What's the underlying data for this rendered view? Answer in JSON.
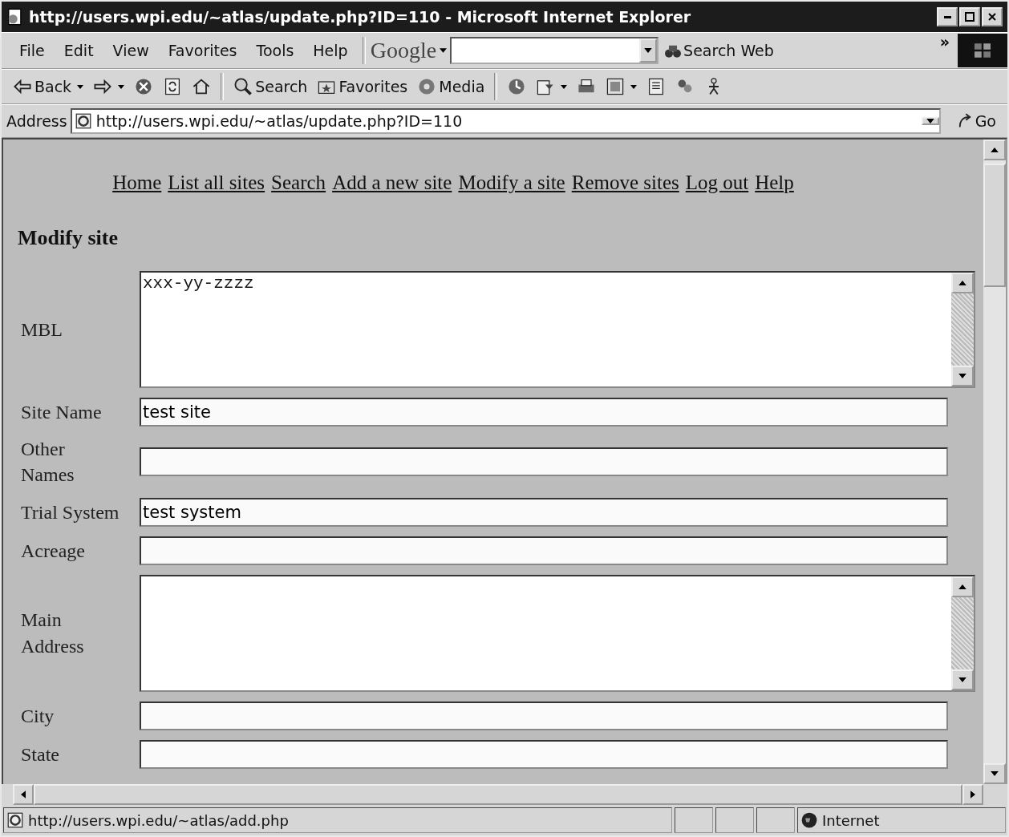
{
  "window": {
    "title": "http://users.wpi.edu/~atlas/update.php?ID=110 - Microsoft Internet Explorer"
  },
  "menu": [
    "File",
    "Edit",
    "View",
    "Favorites",
    "Tools",
    "Help"
  ],
  "google": {
    "logo": "Google",
    "button": "Search Web"
  },
  "chevron": "»",
  "toolbar": [
    {
      "kind": "back",
      "label": "Back"
    },
    {
      "kind": "forward"
    },
    {
      "kind": "stop"
    },
    {
      "kind": "refresh"
    },
    {
      "kind": "home"
    },
    {
      "kind": "search",
      "label": "Search"
    },
    {
      "kind": "favorites",
      "label": "Favorites"
    },
    {
      "kind": "media",
      "label": "Media"
    },
    {
      "kind": "history"
    },
    {
      "kind": "mail"
    },
    {
      "kind": "print"
    },
    {
      "kind": "edit"
    },
    {
      "kind": "discuss"
    },
    {
      "kind": "messenger"
    },
    {
      "kind": "person"
    }
  ],
  "address": {
    "label": "Address",
    "value": "http://users.wpi.edu/~atlas/update.php?ID=110",
    "go": "Go"
  },
  "page": {
    "nav": [
      "Home",
      "List all sites",
      "Search",
      "Add a new site",
      "Modify a site",
      "Remove sites",
      "Log out",
      "Help"
    ],
    "heading": "Modify site",
    "fields": [
      {
        "label": "MBL",
        "kind": "textarea",
        "mono": true,
        "value": "xxx-yy-zzzz"
      },
      {
        "label": "Site Name",
        "kind": "text",
        "value": "test site"
      },
      {
        "label": "Other Names",
        "kind": "text"
      },
      {
        "label": "Trial System",
        "kind": "text",
        "value": "test system"
      },
      {
        "label": "Acreage",
        "kind": "text"
      },
      {
        "label": "Main Address",
        "kind": "textarea"
      },
      {
        "label": "City",
        "kind": "text"
      },
      {
        "label": "State",
        "kind": "text"
      }
    ]
  },
  "status_bar": {
    "url": "http://users.wpi.edu/~atlas/add.php",
    "zone": "Internet"
  }
}
